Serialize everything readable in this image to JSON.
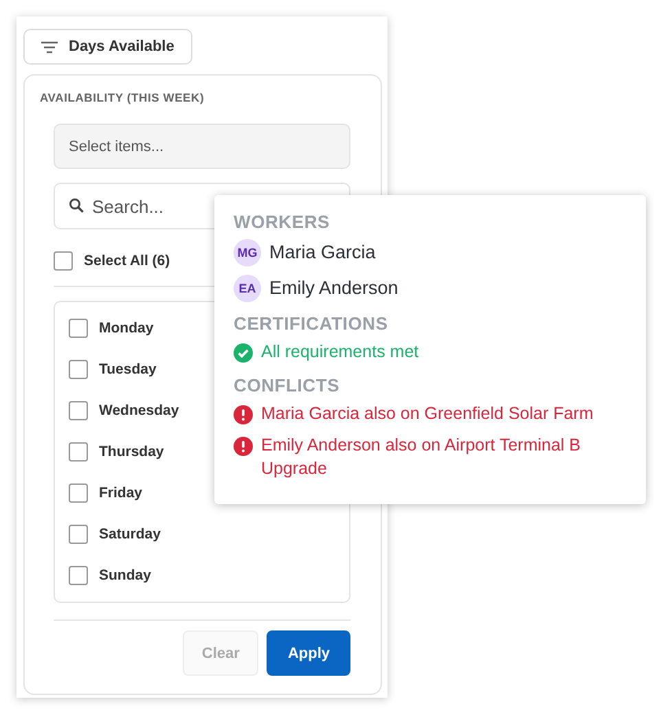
{
  "filter_button": {
    "label": "Days Available"
  },
  "dropdown": {
    "heading": "AVAILABILITY (THIS WEEK)",
    "select_field": {
      "placeholder": "Select items..."
    },
    "search": {
      "placeholder": "Search..."
    },
    "select_all": {
      "label": "Select All (6)",
      "checked": false
    },
    "days": [
      {
        "label": "Monday",
        "checked": false
      },
      {
        "label": "Tuesday",
        "checked": false
      },
      {
        "label": "Wednesday",
        "checked": false
      },
      {
        "label": "Thursday",
        "checked": false
      },
      {
        "label": "Friday",
        "checked": false
      },
      {
        "label": "Saturday",
        "checked": false
      },
      {
        "label": "Sunday",
        "checked": false
      }
    ],
    "buttons": [
      {
        "kind": "secondary",
        "label": "Clear",
        "disabled": true
      },
      {
        "kind": "primary",
        "label": "Apply",
        "disabled": false
      }
    ]
  },
  "tooltip": {
    "sections": [
      {
        "title": "WORKERS",
        "items": [
          {
            "kind": "worker",
            "initials": "MG",
            "text": "Maria Garcia"
          },
          {
            "kind": "worker",
            "initials": "EA",
            "text": "Emily Anderson"
          }
        ]
      },
      {
        "title": "CERTIFICATIONS",
        "items": [
          {
            "kind": "ok",
            "text": "All requirements met"
          }
        ]
      },
      {
        "title": "CONFLICTS",
        "items": [
          {
            "kind": "error",
            "text": "Maria Garcia also on Greenfield Solar Farm"
          },
          {
            "kind": "error",
            "text": "Emily Anderson also on Airport Terminal B Upgrade"
          }
        ]
      }
    ]
  }
}
